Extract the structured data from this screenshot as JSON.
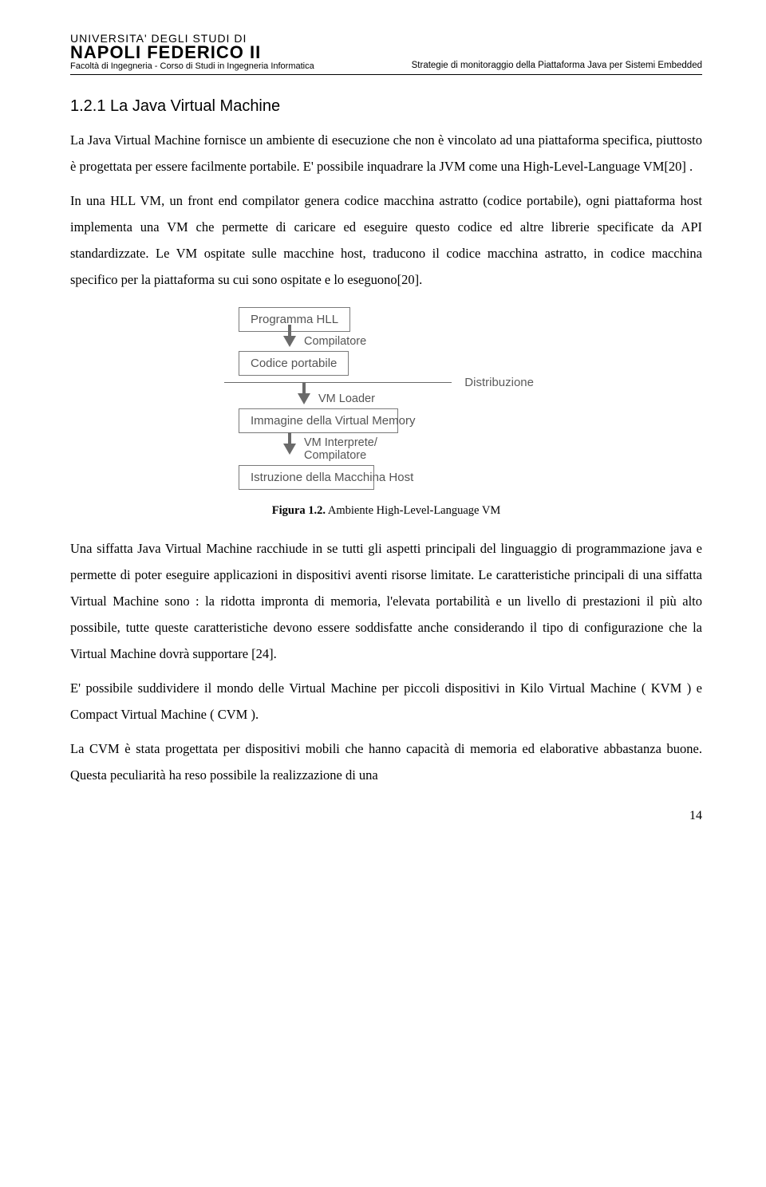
{
  "header": {
    "uni_line1": "UNIVERSITA' DEGLI STUDI DI",
    "uni_line2": "NAPOLI FEDERICO II",
    "faculty": "Facoltà di Ingegneria - Corso di Studi in Ingegneria Informatica",
    "doc_title": "Strategie di monitoraggio della Piattaforma Java per Sistemi Embedded"
  },
  "section_heading": "1.2.1 La Java Virtual Machine",
  "para1": "La Java Virtual Machine fornisce un ambiente di esecuzione che non è vincolato ad una piattaforma specifica, piuttosto è progettata per essere facilmente portabile. E' possibile inquadrare la JVM come una High-Level-Language VM[20] .",
  "para2": "In una HLL VM, un front end compilator genera codice macchina astratto (codice portabile), ogni piattaforma host implementa una VM che permette di caricare ed eseguire questo codice ed altre librerie specificate da API standardizzate. Le VM ospitate sulle macchine host, traducono il codice macchina astratto, in codice macchina specifico per la piattaforma su cui sono ospitate e lo eseguono[20].",
  "figure": {
    "box1": "Programma HLL",
    "arrow1": "Compilatore",
    "box2": "Codice portabile",
    "dist": "Distribuzione",
    "arrow2": "VM Loader",
    "box3": "Immagine della Virtual Memory",
    "arrow3": "VM Interprete/ Compilatore",
    "box4": "Istruzione della Macchina Host",
    "caption_bold": "Figura 1.2.",
    "caption_rest": " Ambiente High-Level-Language VM"
  },
  "para3": "Una siffatta Java Virtual Machine racchiude in se tutti gli aspetti principali del linguaggio di programmazione java e permette di poter eseguire applicazioni in dispositivi aventi risorse limitate. Le caratteristiche principali di una siffatta Virtual Machine sono : la ridotta impronta di memoria, l'elevata portabilità e un livello di prestazioni il più alto possibile, tutte queste caratteristiche devono essere soddisfatte anche considerando il tipo di configurazione che la Virtual Machine dovrà supportare [24].",
  "para4": "E' possibile suddividere il mondo delle Virtual Machine per piccoli dispositivi in Kilo Virtual Machine ( KVM ) e Compact Virtual Machine ( CVM ).",
  "para5": "La CVM è stata progettata per dispositivi mobili che hanno capacità di memoria ed elaborative abbastanza buone. Questa peculiarità ha reso possibile la realizzazione di una",
  "page_number": "14"
}
